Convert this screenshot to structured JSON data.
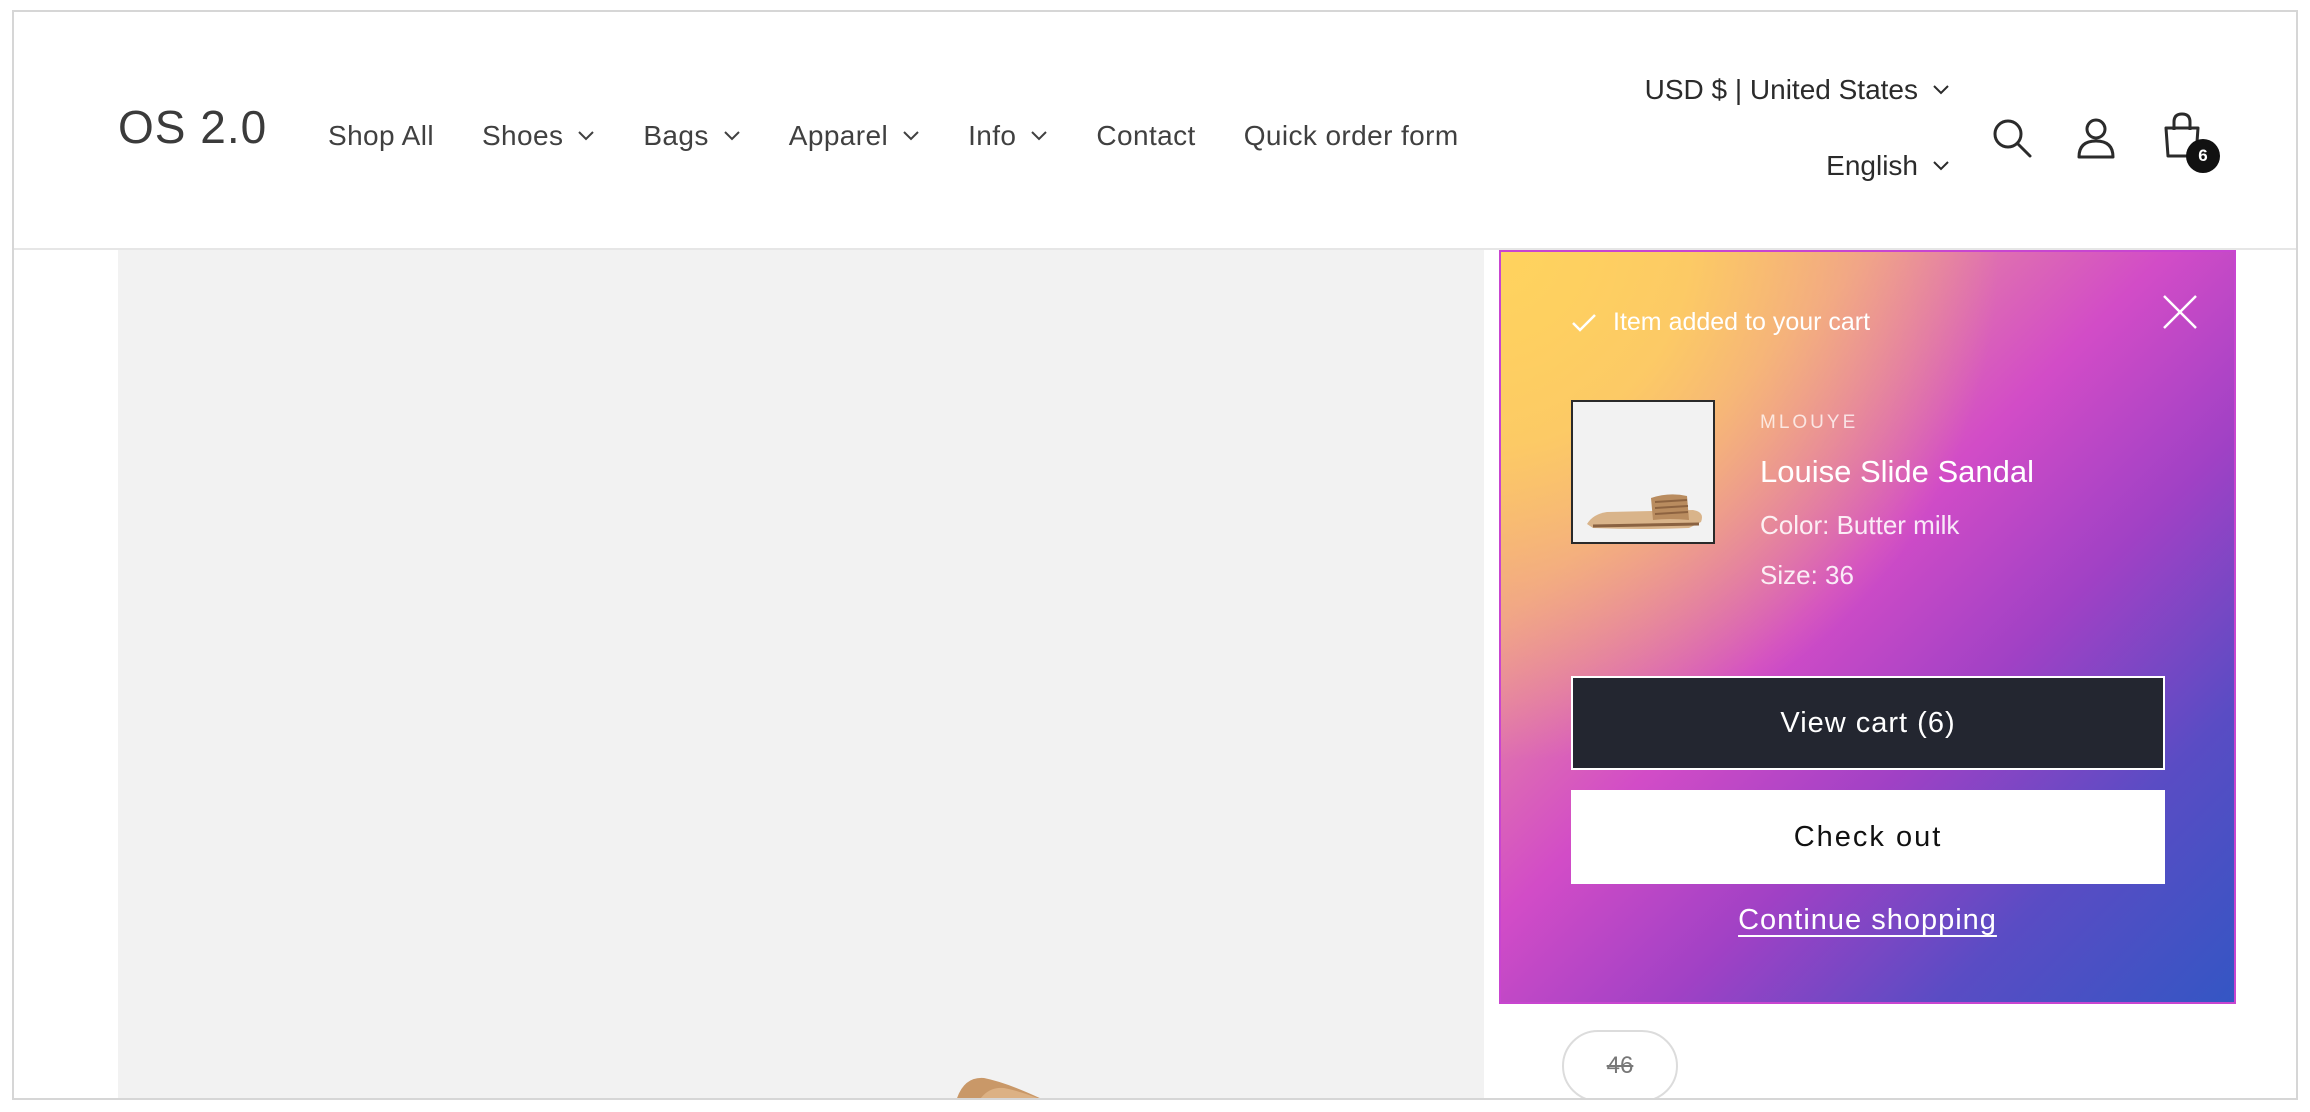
{
  "header": {
    "logo": "OS 2.0",
    "nav": [
      {
        "label": "Shop All",
        "dropdown": false
      },
      {
        "label": "Shoes",
        "dropdown": true
      },
      {
        "label": "Bags",
        "dropdown": true
      },
      {
        "label": "Apparel",
        "dropdown": true
      },
      {
        "label": "Info",
        "dropdown": true
      },
      {
        "label": "Contact",
        "dropdown": false
      },
      {
        "label": "Quick order form",
        "dropdown": false
      }
    ],
    "currency": "USD $ | United States",
    "language": "English",
    "cart_count": "6",
    "icons": [
      "search-icon",
      "account-icon",
      "cart-icon"
    ]
  },
  "product": {
    "visible_size_option": "46"
  },
  "cart_popup": {
    "status": "Item added to your cart",
    "vendor": "MLOUYE",
    "product_name": "Louise Slide Sandal",
    "color": "Color: Butter milk",
    "size": "Size: 36",
    "view_cart_label": "View cart (6)",
    "checkout_label": "Check out",
    "continue_label": "Continue shopping"
  },
  "colors": {
    "primary_button": "#232630",
    "gradient_start": "#ffd35e",
    "gradient_mid": "#d24cc7",
    "gradient_end": "#3456c4"
  }
}
